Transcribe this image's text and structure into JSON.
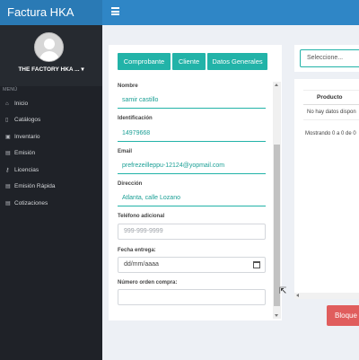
{
  "app": {
    "title": "Factura HKA"
  },
  "sidebar": {
    "profile_name": "THE FACTORY HKA ... ▾",
    "menu_title": "MENÚ",
    "items": [
      {
        "label": "Inicio",
        "icon": "home-icon"
      },
      {
        "label": "Catálogos",
        "icon": "book-icon"
      },
      {
        "label": "Inventario",
        "icon": "cubes-icon"
      },
      {
        "label": "Emisión",
        "icon": "document-icon"
      },
      {
        "label": "Licencias",
        "icon": "key-icon"
      },
      {
        "label": "Emisión Rápida",
        "icon": "document-icon"
      },
      {
        "label": "Cotizaciones",
        "icon": "document-icon"
      }
    ]
  },
  "tabs": {
    "comprobante": "Comprobante",
    "cliente": "Cliente",
    "datos_generales": "Datos Generales"
  },
  "form": {
    "nombre_label": "Nombre",
    "nombre_value": "samir castillo",
    "identificacion_label": "Identificación",
    "identificacion_value": "14979668",
    "email_label": "Email",
    "email_value": "prefrezeilleppu-12124@yopmail.com",
    "direccion_label": "Dirección",
    "direccion_value": "Atlanta, calle Lozano",
    "telefono_label": "Teléfono adicional",
    "telefono_placeholder": "999-999-9999",
    "fecha_label": "Fecha entrega:",
    "fecha_placeholder": "dd/mm/aaaa",
    "orden_label": "Número orden compra:",
    "orden_value": ""
  },
  "right": {
    "select_placeholder": "Seleccione...",
    "table_header": "Producto",
    "empty_text": "No hay datos dispon",
    "info_text": "Mostrando 0 a 0 de 0",
    "bloquear_button": "Bloque"
  },
  "colors": {
    "accent": "#22b3a8",
    "topbar": "#2f86c6",
    "sidebar": "#1f2228",
    "danger": "#e05d5d"
  }
}
